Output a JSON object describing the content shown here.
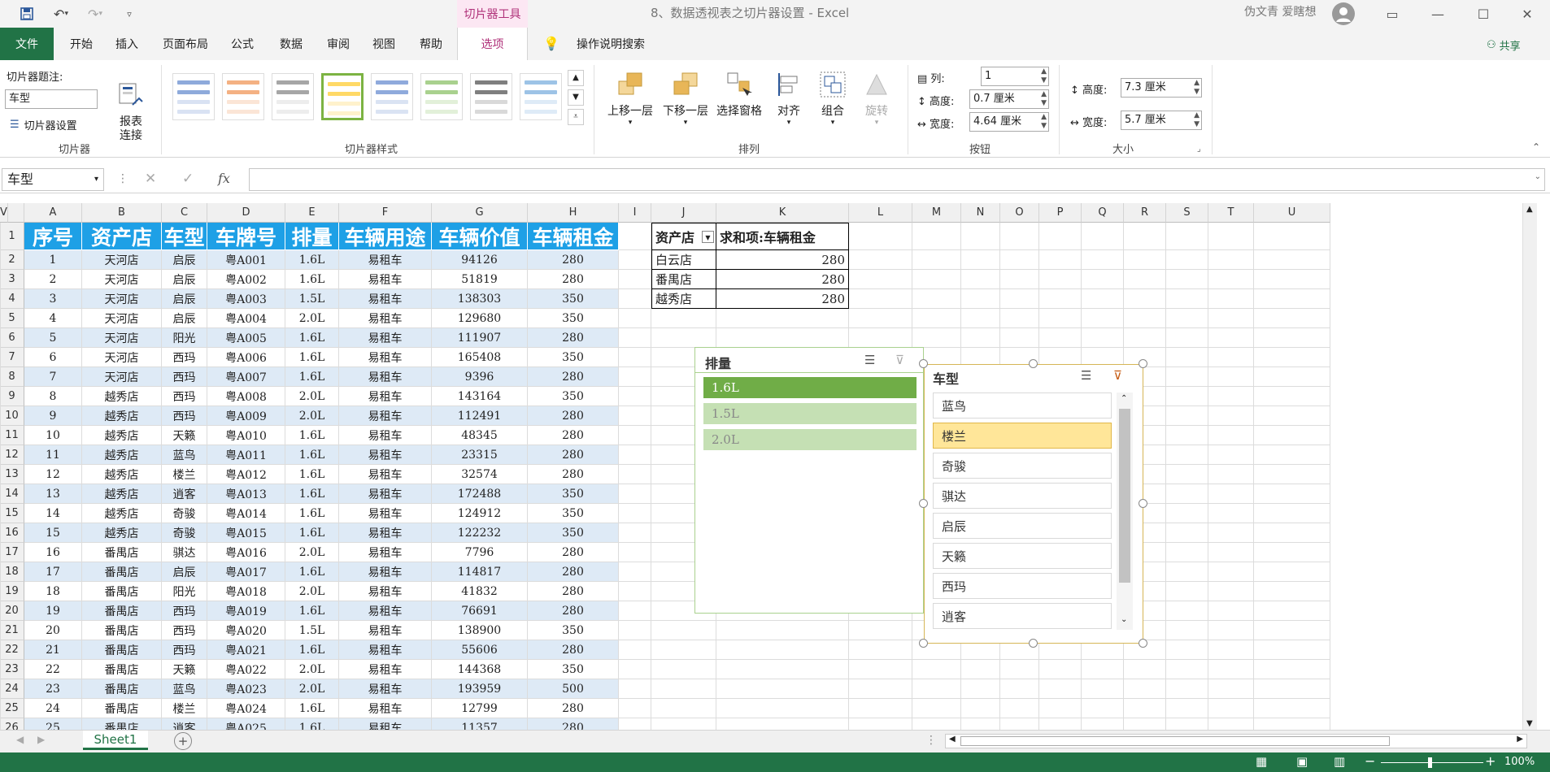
{
  "titlebar": {
    "context_tool": "切片器工具",
    "doc_title": "8、数据透视表之切片器设置  -  Excel",
    "user": "伪文青 爱瞎想"
  },
  "tabs": [
    "文件",
    "开始",
    "插入",
    "页面布局",
    "公式",
    "数据",
    "审阅",
    "视图",
    "帮助",
    "选项"
  ],
  "tellme": "操作说明搜索",
  "share": "共享",
  "ribbon": {
    "caption_label": "切片器题注:",
    "caption_value": "车型",
    "slicer_settings": "切片器设置",
    "report_connections": "报表\n连接",
    "group_slicer": "切片器",
    "group_styles": "切片器样式",
    "arrange": {
      "bring_forward": "上移一层",
      "send_backward": "下移一层",
      "selection_pane": "选择窗格",
      "align": "对齐",
      "group": "组合",
      "rotate": "旋转",
      "label": "排列"
    },
    "buttons": {
      "columns_label": "列:",
      "columns_value": "1",
      "height_label": "高度:",
      "height_value": "0.7 厘米",
      "width_label": "宽度:",
      "width_value": "4.64 厘米",
      "label": "按钮"
    },
    "size": {
      "height_label": "高度:",
      "height_value": "7.3 厘米",
      "width_label": "宽度:",
      "width_value": "5.7 厘米",
      "label": "大小"
    }
  },
  "formula_bar": {
    "name_box": "车型",
    "fx": "fx"
  },
  "columns": [
    "A",
    "B",
    "C",
    "D",
    "E",
    "F",
    "G",
    "H",
    "I",
    "J",
    "K",
    "L",
    "M",
    "N",
    "O",
    "P",
    "Q",
    "R",
    "S",
    "T",
    "U",
    "V"
  ],
  "headers": [
    "序号",
    "资产店",
    "车型",
    "车牌号",
    "排量",
    "车辆用途",
    "车辆价值",
    "车辆租金"
  ],
  "rows": [
    [
      "1",
      "天河店",
      "启辰",
      "粤A001",
      "1.6L",
      "易租车",
      "94126",
      "280"
    ],
    [
      "2",
      "天河店",
      "启辰",
      "粤A002",
      "1.6L",
      "易租车",
      "51819",
      "280"
    ],
    [
      "3",
      "天河店",
      "启辰",
      "粤A003",
      "1.5L",
      "易租车",
      "138303",
      "350"
    ],
    [
      "4",
      "天河店",
      "启辰",
      "粤A004",
      "2.0L",
      "易租车",
      "129680",
      "350"
    ],
    [
      "5",
      "天河店",
      "阳光",
      "粤A005",
      "1.6L",
      "易租车",
      "111907",
      "280"
    ],
    [
      "6",
      "天河店",
      "西玛",
      "粤A006",
      "1.6L",
      "易租车",
      "165408",
      "350"
    ],
    [
      "7",
      "天河店",
      "西玛",
      "粤A007",
      "1.6L",
      "易租车",
      "9396",
      "280"
    ],
    [
      "8",
      "越秀店",
      "西玛",
      "粤A008",
      "2.0L",
      "易租车",
      "143164",
      "350"
    ],
    [
      "9",
      "越秀店",
      "西玛",
      "粤A009",
      "2.0L",
      "易租车",
      "112491",
      "280"
    ],
    [
      "10",
      "越秀店",
      "天籁",
      "粤A010",
      "1.6L",
      "易租车",
      "48345",
      "280"
    ],
    [
      "11",
      "越秀店",
      "蓝鸟",
      "粤A011",
      "1.6L",
      "易租车",
      "23315",
      "280"
    ],
    [
      "12",
      "越秀店",
      "楼兰",
      "粤A012",
      "1.6L",
      "易租车",
      "32574",
      "280"
    ],
    [
      "13",
      "越秀店",
      "逍客",
      "粤A013",
      "1.6L",
      "易租车",
      "172488",
      "350"
    ],
    [
      "14",
      "越秀店",
      "奇骏",
      "粤A014",
      "1.6L",
      "易租车",
      "124912",
      "350"
    ],
    [
      "15",
      "越秀店",
      "奇骏",
      "粤A015",
      "1.6L",
      "易租车",
      "122232",
      "350"
    ],
    [
      "16",
      "番禺店",
      "骐达",
      "粤A016",
      "2.0L",
      "易租车",
      "7796",
      "280"
    ],
    [
      "17",
      "番禺店",
      "启辰",
      "粤A017",
      "1.6L",
      "易租车",
      "114817",
      "280"
    ],
    [
      "18",
      "番禺店",
      "阳光",
      "粤A018",
      "2.0L",
      "易租车",
      "41832",
      "280"
    ],
    [
      "19",
      "番禺店",
      "西玛",
      "粤A019",
      "1.6L",
      "易租车",
      "76691",
      "280"
    ],
    [
      "20",
      "番禺店",
      "西玛",
      "粤A020",
      "1.5L",
      "易租车",
      "138900",
      "350"
    ],
    [
      "21",
      "番禺店",
      "西玛",
      "粤A021",
      "1.6L",
      "易租车",
      "55606",
      "280"
    ],
    [
      "22",
      "番禺店",
      "天籁",
      "粤A022",
      "2.0L",
      "易租车",
      "144368",
      "350"
    ],
    [
      "23",
      "番禺店",
      "蓝鸟",
      "粤A023",
      "2.0L",
      "易租车",
      "193959",
      "500"
    ],
    [
      "24",
      "番禺店",
      "楼兰",
      "粤A024",
      "1.6L",
      "易租车",
      "12799",
      "280"
    ],
    [
      "25",
      "番禺店",
      "逍客",
      "粤A025",
      "1.6L",
      "易租车",
      "11357",
      "280"
    ]
  ],
  "pivot": {
    "header_store": "资产店",
    "header_sum": "求和项:车辆租金",
    "rows": [
      [
        "白云店",
        "280"
      ],
      [
        "番禺店",
        "280"
      ],
      [
        "越秀店",
        "280"
      ]
    ]
  },
  "slicer_displacement": {
    "title": "排量",
    "items": [
      "1.6L",
      "1.5L",
      "2.0L"
    ],
    "selected": "1.6L",
    "color_selected": "#70ad47",
    "color_item": "#c5e0b4"
  },
  "slicer_model": {
    "title": "车型",
    "items": [
      "蓝鸟",
      "楼兰",
      "奇骏",
      "骐达",
      "启辰",
      "天籁",
      "西玛",
      "逍客"
    ],
    "selected": "楼兰",
    "color_selected": "#ffe699"
  },
  "sheet_tab": "Sheet1",
  "zoom": "100%"
}
